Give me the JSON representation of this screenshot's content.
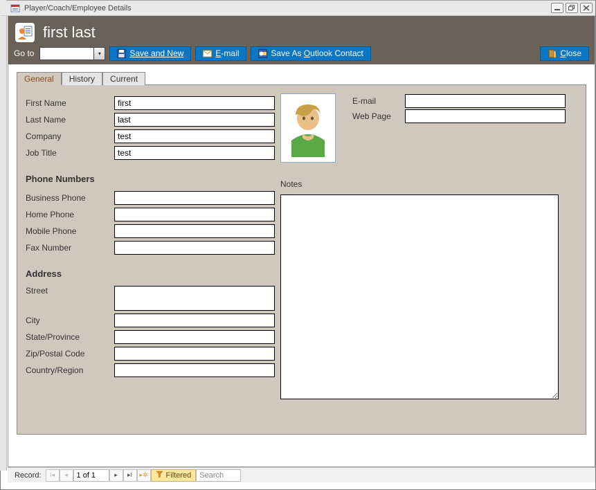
{
  "window": {
    "title": "Player/Coach/Employee Details"
  },
  "header": {
    "title": "first last"
  },
  "toolbar": {
    "goto_label": "Go to",
    "save_new": "Save and New",
    "email_pre": "E",
    "email_post": "-mail",
    "save_outlook_pre": "Save As ",
    "save_outlook_u": "O",
    "save_outlook_post": "utlook Contact",
    "close_u": "C",
    "close_post": "lose"
  },
  "tabs": [
    {
      "label": "General"
    },
    {
      "label": "History"
    },
    {
      "label": "Current"
    }
  ],
  "fields": {
    "first_name_label": "First Name",
    "first_name": "first",
    "last_name_label": "Last Name",
    "last_name": "last",
    "company_label": "Company",
    "company": "test",
    "job_title_label": "Job Title",
    "job_title": "test",
    "phone_section": "Phone Numbers",
    "business_phone_label": "Business Phone",
    "business_phone": "",
    "home_phone_label": "Home Phone",
    "home_phone": "",
    "mobile_phone_label": "Mobile Phone",
    "mobile_phone": "",
    "fax_label": "Fax Number",
    "fax": "",
    "address_section": "Address",
    "street_label": "Street",
    "street": "",
    "city_label": "City",
    "city": "",
    "state_label": "State/Province",
    "state": "",
    "zip_label": "Zip/Postal Code",
    "zip": "",
    "country_label": "Country/Region",
    "country": "",
    "email_label": "E-mail",
    "email": "",
    "web_label": "Web Page",
    "web": "",
    "notes_label": "Notes",
    "notes": ""
  },
  "footer": {
    "record_label": "Record:",
    "record_text": "1 of 1",
    "filtered": "Filtered",
    "search_placeholder": "Search"
  }
}
